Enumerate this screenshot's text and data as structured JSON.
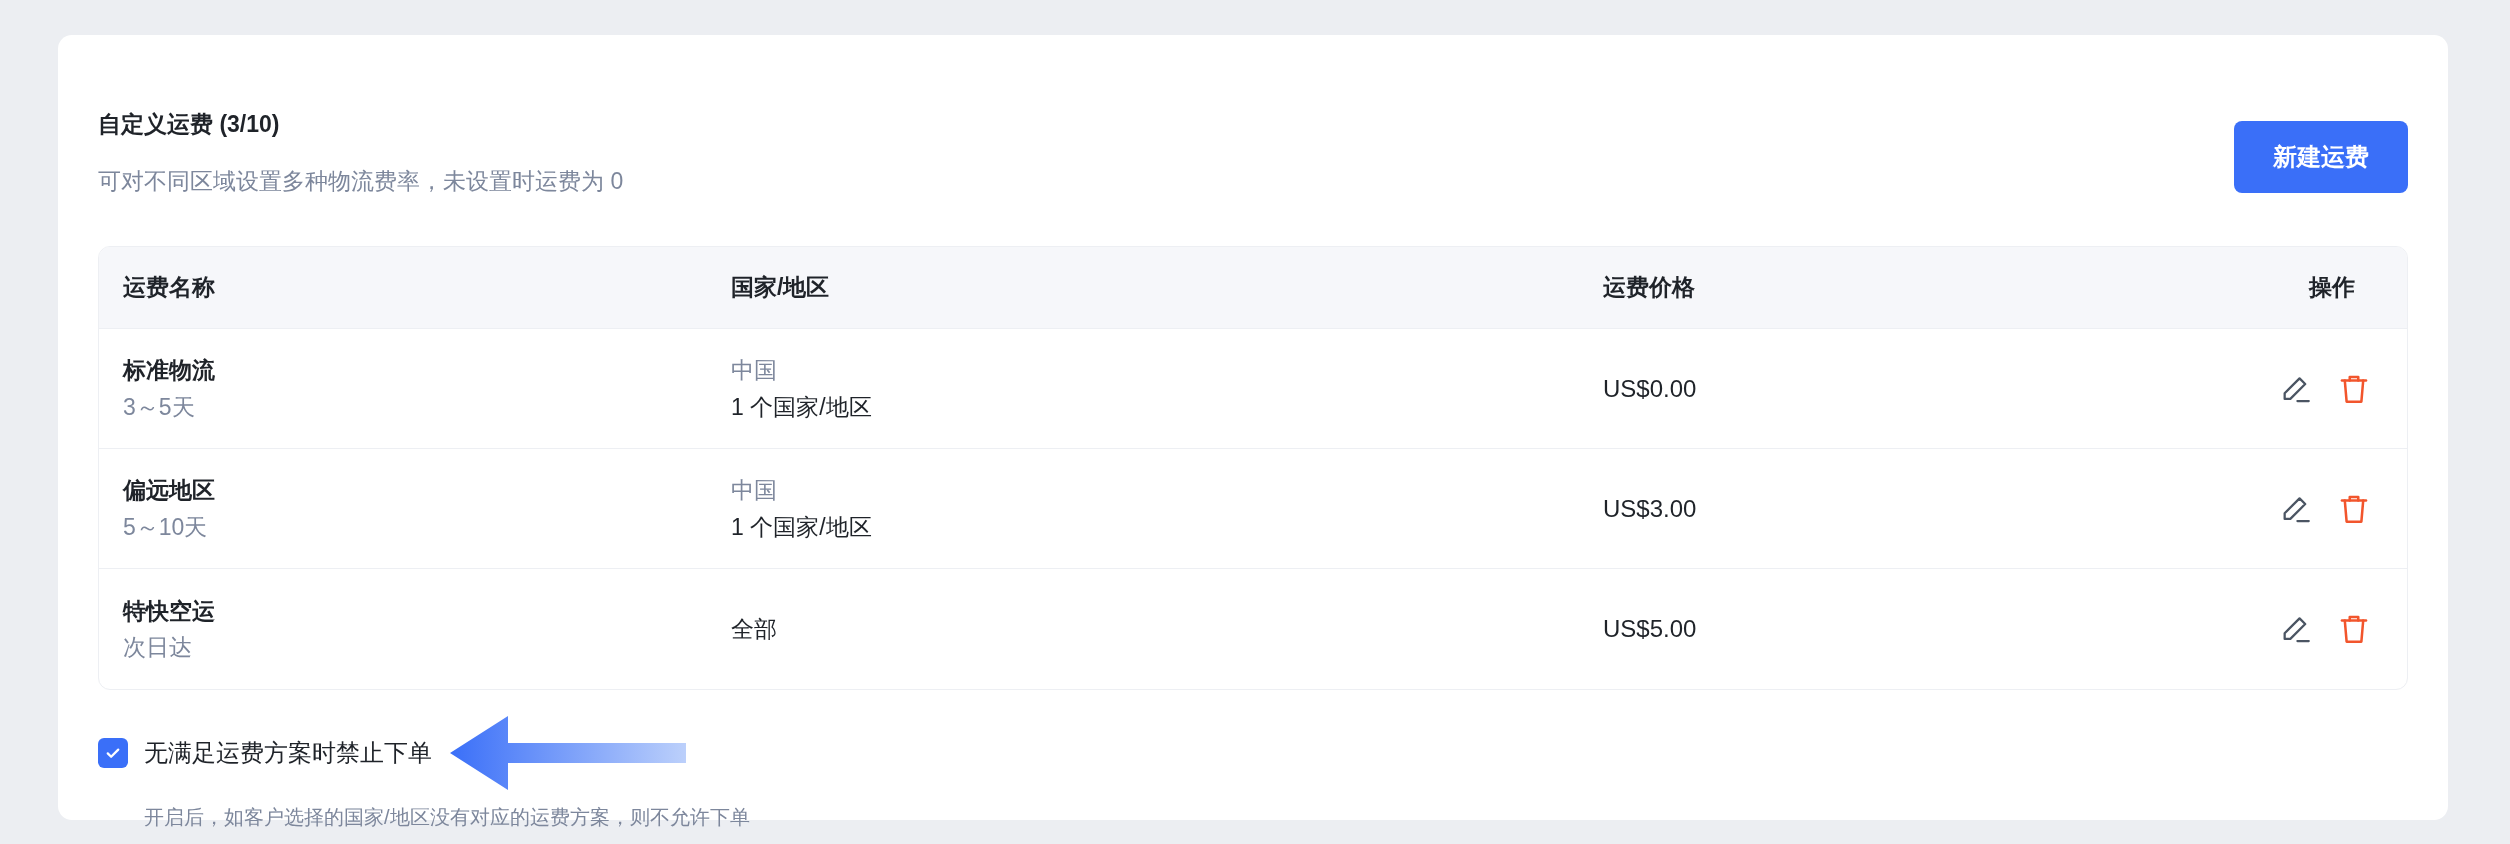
{
  "header": {
    "title": "自定义运费 (3/10)",
    "subtitle": "可对不同区域设置多种物流费率，未设置时运费为 0",
    "button": "新建运费"
  },
  "table": {
    "columns": [
      "运费名称",
      "国家/地区",
      "运费价格",
      "操作"
    ],
    "rows": [
      {
        "name": "标准物流",
        "duration": "3～5天",
        "region": "中国",
        "countries": "1 个国家/地区",
        "price": "US$0.00"
      },
      {
        "name": "偏远地区",
        "duration": "5～10天",
        "region": "中国",
        "countries": "1 个国家/地区",
        "price": "US$3.00"
      },
      {
        "name": "特快空运",
        "duration": "次日达",
        "countries": "全部",
        "price": "US$5.00"
      }
    ]
  },
  "option": {
    "label": "无满足运费方案时禁止下单",
    "checked": true,
    "hint": "开启后，如客户选择的国家/地区没有对应的运费方案，则不允许下单"
  }
}
